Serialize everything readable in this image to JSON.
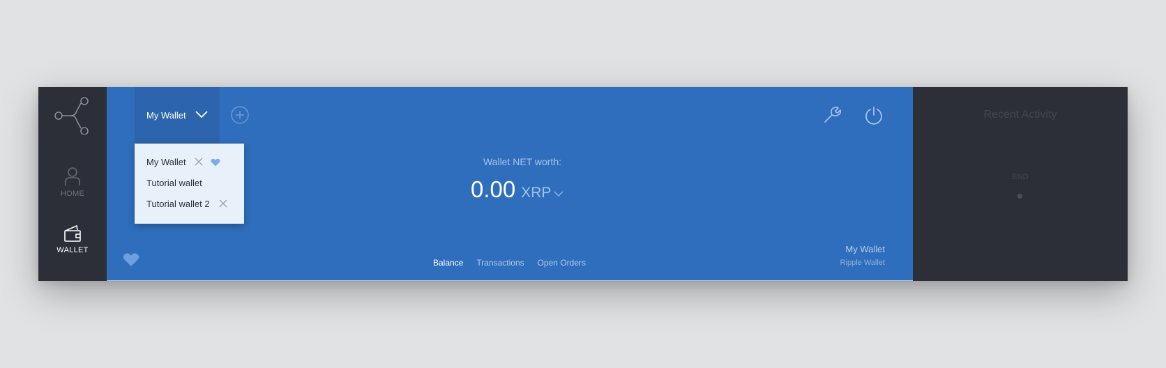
{
  "sidebar": {
    "logo_icon": "ripple-logo-icon",
    "items": [
      {
        "label": "HOME",
        "icon": "person-icon",
        "active": false
      },
      {
        "label": "WALLET",
        "icon": "wallet-icon",
        "active": true
      }
    ]
  },
  "header": {
    "selected_wallet": "My Wallet",
    "add_icon": "plus-circle-icon",
    "settings_icon": "wrench-icon",
    "power_icon": "power-icon"
  },
  "dropdown": {
    "items": [
      {
        "label": "My Wallet",
        "removable": true,
        "favorite": true
      },
      {
        "label": "Tutorial wallet",
        "removable": false,
        "favorite": false
      },
      {
        "label": "Tutorial wallet 2",
        "removable": true,
        "favorite": false
      }
    ]
  },
  "networth": {
    "label": "Wallet NET worth:",
    "value": "0.00",
    "currency": "XRP"
  },
  "tabs": [
    {
      "label": "Balance",
      "active": true
    },
    {
      "label": "Transactions",
      "active": false
    },
    {
      "label": "Open Orders",
      "active": false
    }
  ],
  "wallet_info": {
    "name": "My Wallet",
    "type": "Ripple Wallet"
  },
  "activity": {
    "title": "Recent Activity",
    "end_label": "END"
  },
  "colors": {
    "main_blue": "#2f6ebd",
    "sidebar": "#2c2f37",
    "dropdown_bg": "#e8f0fa",
    "heart_accent": "#7eaaf0"
  }
}
